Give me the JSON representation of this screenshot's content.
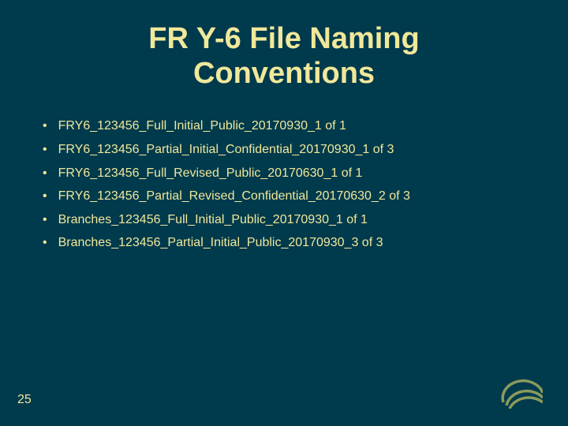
{
  "title_line1": "FR Y-6 File Naming",
  "title_line2": "Conventions",
  "items": [
    "FRY6_123456_Full_Initial_Public_20170930_1 of 1",
    "FRY6_123456_Partial_Initial_Confidential_20170930_1 of 3",
    "FRY6_123456_Full_Revised_Public_20170630_1 of 1",
    "FRY6_123456_Partial_Revised_Confidential_20170630_2 of 3",
    "Branches_123456_Full_Initial_Public_20170930_1 of 1",
    "Branches_123456_Partial_Initial_Public_20170930_3 of 3"
  ],
  "page_number": "25"
}
